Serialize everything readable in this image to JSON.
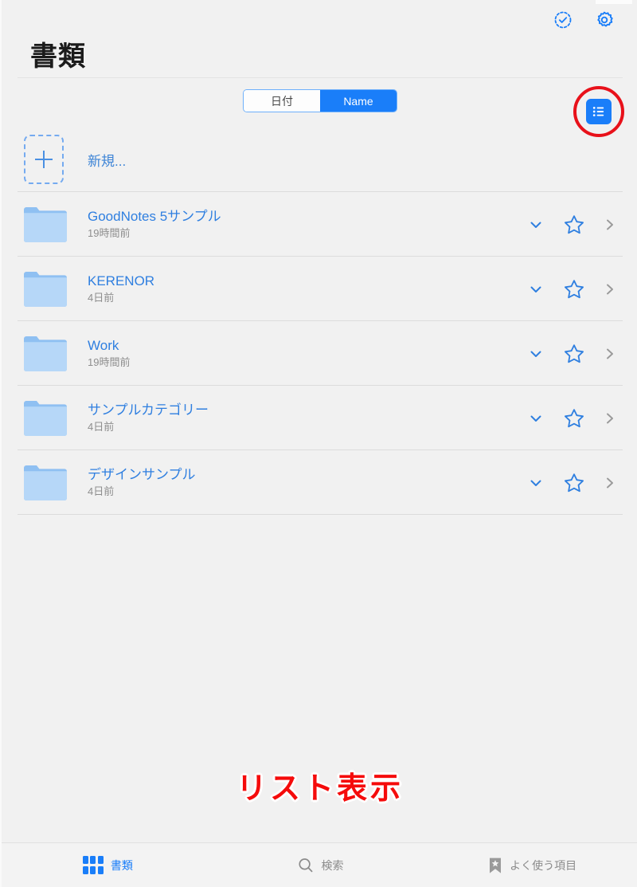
{
  "app": {
    "title": "書類",
    "background_color": "#f1f1f1",
    "accent_color": "#1a7ef9",
    "annotation_color": "#f50b0b"
  },
  "topbar": {
    "select_icon": "check-circle-dashed-icon",
    "settings_icon": "gear-icon"
  },
  "sort_control": {
    "options": [
      {
        "label": "日付",
        "active": false
      },
      {
        "label": "Name",
        "active": true
      }
    ]
  },
  "view_toggle": {
    "icon": "list-view-icon",
    "highlighted": true,
    "highlight_color": "#e8111a"
  },
  "new_item": {
    "icon": "plus-icon",
    "label": "新規..."
  },
  "folders": [
    {
      "name": "GoodNotes 5サンプル",
      "date": "19時間前",
      "icon": "folder-icon"
    },
    {
      "name": "KERENOR",
      "date": "4日前",
      "icon": "folder-icon"
    },
    {
      "name": "Work",
      "date": "19時間前",
      "icon": "folder-icon"
    },
    {
      "name": "サンプルカテゴリー",
      "date": "4日前",
      "icon": "folder-icon"
    },
    {
      "name": "デザインサンプル",
      "date": "4日前",
      "icon": "folder-icon"
    }
  ],
  "row_actions": {
    "expand_icon": "chevron-down-icon",
    "favorite_icon": "star-outline-icon",
    "disclosure_icon": "chevron-right-icon"
  },
  "annotation": {
    "text": "リスト表示"
  },
  "tabbar": {
    "tabs": [
      {
        "label": "書類",
        "icon": "grid-icon",
        "active": true
      },
      {
        "label": "検索",
        "icon": "search-icon",
        "active": false
      },
      {
        "label": "よく使う項目",
        "icon": "bookmark-star-icon",
        "active": false
      }
    ]
  }
}
